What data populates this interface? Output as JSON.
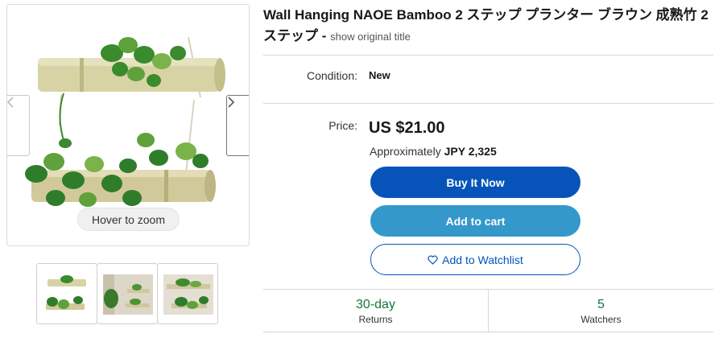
{
  "gallery": {
    "zoom_hint": "Hover to zoom",
    "prev_icon": "chevron-left-icon",
    "next_icon": "chevron-right-icon"
  },
  "item": {
    "title": "Wall Hanging NAOE Bamboo 2 ステップ プランター ブラウン 成熟竹 2ステップ - ",
    "show_original": "show original title"
  },
  "condition": {
    "label": "Condition:",
    "value": "New"
  },
  "price": {
    "label": "Price:",
    "value": "US $21.00",
    "approx_prefix": "Approximately ",
    "approx_value": "JPY 2,325"
  },
  "actions": {
    "buy_now": "Buy It Now",
    "add_to_cart": "Add to cart",
    "add_to_watchlist": "Add to Watchlist",
    "watch_icon": "heart-icon"
  },
  "stats": [
    {
      "value": "30-day",
      "label": "Returns"
    },
    {
      "value": "5",
      "label": "Watchers"
    }
  ],
  "colors": {
    "buy_now": "#0654ba",
    "add_to_cart": "#3498ca",
    "stat_green": "#16763a",
    "bamboo": "#d8d3a4",
    "leaf": "#2f7d2a"
  }
}
